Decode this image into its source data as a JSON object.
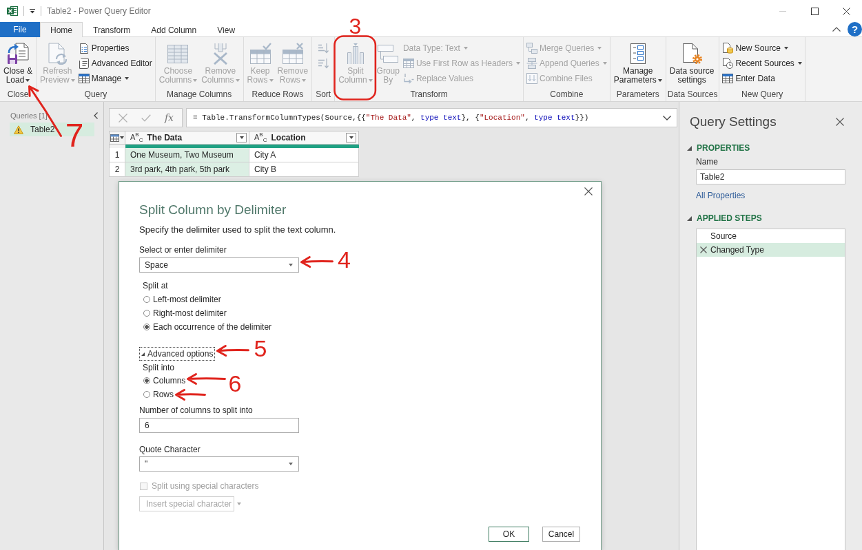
{
  "window": {
    "title": "Table2 - Power Query Editor"
  },
  "tabs": [
    {
      "label": "File",
      "kind": "file",
      "selected": false
    },
    {
      "label": "Home",
      "kind": "tab",
      "selected": true
    },
    {
      "label": "Transform",
      "kind": "tab",
      "selected": false
    },
    {
      "label": "Add Column",
      "kind": "tab",
      "selected": false
    },
    {
      "label": "View",
      "kind": "tab",
      "selected": false
    }
  ],
  "help_button": "?",
  "ribbon": {
    "groups": [
      {
        "label": "Close",
        "items": [
          {
            "kind": "large",
            "label": "Close &\nLoad",
            "dropdown": true,
            "disabled": false,
            "annotation": {
              "label": "7",
              "kind": "arrow_up"
            }
          }
        ]
      },
      {
        "label": "Query",
        "items": [
          {
            "kind": "large",
            "label": "Refresh\nPreview",
            "dropdown": true,
            "disabled": true
          },
          {
            "kind": "small",
            "label": "Properties",
            "dropdown": false,
            "disabled": false
          },
          {
            "kind": "small",
            "label": "Advanced Editor",
            "dropdown": false,
            "disabled": false
          },
          {
            "kind": "small",
            "label": "Manage",
            "dropdown": true,
            "disabled": false
          }
        ]
      },
      {
        "label": "Manage Columns",
        "items": [
          {
            "kind": "large",
            "label": "Choose\nColumns",
            "dropdown": true,
            "disabled": true
          },
          {
            "kind": "large",
            "label": "Remove\nColumns",
            "dropdown": true,
            "disabled": true
          }
        ]
      },
      {
        "label": "Reduce Rows",
        "items": [
          {
            "kind": "large",
            "label": "Keep\nRows",
            "dropdown": true,
            "disabled": true
          },
          {
            "kind": "large",
            "label": "Remove\nRows",
            "dropdown": true,
            "disabled": true
          }
        ]
      },
      {
        "label": "Sort",
        "items": [
          {
            "kind": "icon",
            "disabled": true
          },
          {
            "kind": "icon",
            "disabled": true
          }
        ]
      },
      {
        "label": "Transform",
        "items": [
          {
            "kind": "large",
            "label": "Split\nColumn",
            "dropdown": true,
            "disabled": true,
            "annotation": {
              "label": "3",
              "kind": "ring"
            }
          },
          {
            "kind": "large",
            "label": "Group\nBy",
            "dropdown": false,
            "disabled": true
          },
          {
            "kind": "small",
            "label": "Data Type: Text",
            "dropdown": true,
            "disabled": true
          },
          {
            "kind": "small",
            "label": "Use First Row as Headers",
            "dropdown": true,
            "disabled": true
          },
          {
            "kind": "small",
            "label": "Replace Values",
            "dropdown": false,
            "disabled": true
          }
        ]
      },
      {
        "label": "Combine",
        "items": [
          {
            "kind": "small",
            "label": "Merge Queries",
            "dropdown": true,
            "disabled": true
          },
          {
            "kind": "small",
            "label": "Append Queries",
            "dropdown": true,
            "disabled": true
          },
          {
            "kind": "small",
            "label": "Combine Files",
            "dropdown": false,
            "disabled": true
          }
        ]
      },
      {
        "label": "Parameters",
        "items": [
          {
            "kind": "large",
            "label": "Manage\nParameters",
            "dropdown": true,
            "disabled": false
          }
        ]
      },
      {
        "label": "Data Sources",
        "items": [
          {
            "kind": "large",
            "label": "Data source\nsettings",
            "dropdown": false,
            "disabled": false
          }
        ]
      },
      {
        "label": "New Query",
        "items": [
          {
            "kind": "small",
            "label": "New Source",
            "dropdown": true,
            "disabled": false
          },
          {
            "kind": "small",
            "label": "Recent Sources",
            "dropdown": true,
            "disabled": false
          },
          {
            "kind": "small",
            "label": "Enter Data",
            "dropdown": false,
            "disabled": false
          }
        ]
      }
    ]
  },
  "queries_pane": {
    "title": "Queries [1]",
    "items": [
      {
        "name": "Table2",
        "selected": true,
        "warning": true
      }
    ]
  },
  "formula_bar": {
    "function_label": "fx",
    "formula": [
      {
        "text": "= Table.TransformColumnTypes(Source,{{",
        "kind": "code"
      },
      {
        "text": "\"The Data\"",
        "kind": "string"
      },
      {
        "text": ", ",
        "kind": "code"
      },
      {
        "text": "type text",
        "kind": "keyword"
      },
      {
        "text": "}, {",
        "kind": "code"
      },
      {
        "text": "\"Location\"",
        "kind": "string"
      },
      {
        "text": ", ",
        "kind": "code"
      },
      {
        "text": "type text",
        "kind": "keyword"
      },
      {
        "text": "}})",
        "kind": "code"
      }
    ]
  },
  "table": {
    "columns": [
      {
        "name": "The Data",
        "type_label": "A$^{B}$$_{C}$",
        "selected": true
      },
      {
        "name": "Location",
        "type_label": "A$^{B}$$_{C}$",
        "selected": false
      }
    ],
    "rows": [
      {
        "number": "1",
        "cells": [
          "One Museum, Two Museum",
          "City A"
        ]
      },
      {
        "number": "2",
        "cells": [
          "3rd park, 4th park, 5th park",
          "City B"
        ]
      }
    ]
  },
  "dialog": {
    "title": "Split Column by Delimiter",
    "description": "Specify the delimiter used to split the text column.",
    "delimiter": {
      "label": "Select or enter delimiter",
      "value": "Space",
      "annotation": {
        "label": "4",
        "kind": "arrow_left"
      }
    },
    "split_at": {
      "label": "Split at",
      "options": [
        {
          "label": "Left-most delimiter",
          "selected": false
        },
        {
          "label": "Right-most delimiter",
          "selected": false
        },
        {
          "label": "Each occurrence of the delimiter",
          "selected": true
        }
      ]
    },
    "advanced_options": {
      "label": "Advanced options",
      "expanded": true,
      "focused": true,
      "annotation": {
        "label": "5",
        "kind": "arrow_left"
      }
    },
    "split_into": {
      "label": "Split into",
      "options": [
        {
          "label": "Columns",
          "selected": true
        },
        {
          "label": "Rows",
          "selected": false
        }
      ],
      "annotation": {
        "label": "6",
        "kind": "arrows_left"
      }
    },
    "column_count": {
      "label": "Number of columns to split into",
      "value": "6"
    },
    "quote_character": {
      "label": "Quote Character",
      "value": "\""
    },
    "special_characters": {
      "label": "Split using special characters",
      "checked": false,
      "disabled": true
    },
    "insert_special_character": {
      "label": "Insert special character",
      "disabled": true
    },
    "buttons": [
      {
        "label": "OK",
        "kind": "primary"
      },
      {
        "label": "Cancel",
        "kind": "secondary"
      }
    ]
  },
  "query_settings": {
    "title": "Query Settings",
    "properties": {
      "heading": "PROPERTIES",
      "expanded": true,
      "name_label": "Name",
      "name_value": "Table2",
      "link": "All Properties"
    },
    "applied_steps": {
      "heading": "APPLIED STEPS",
      "expanded": true,
      "steps": [
        {
          "name": "Source",
          "selected": false
        },
        {
          "name": "Changed Type",
          "selected": true
        }
      ]
    }
  }
}
